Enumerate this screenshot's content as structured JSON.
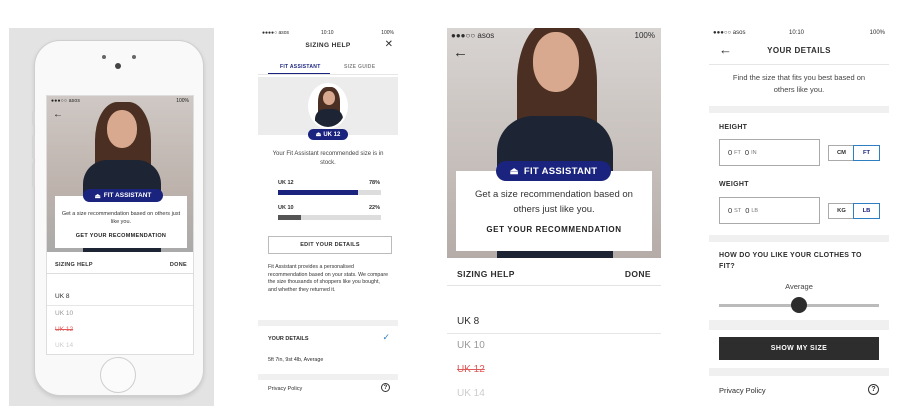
{
  "phone_preview": {
    "status_left": "●●●○○ asos",
    "status_right": "100%",
    "badge_label": "FIT ASSISTANT",
    "card_text": "Get a size recommendation based on others just like you.",
    "card_cta": "GET YOUR RECOMMENDATION",
    "bar_title": "SIZING HELP",
    "bar_done": "DONE",
    "sizes": [
      "UK 8",
      "UK 10",
      "UK 12",
      "UK 14"
    ]
  },
  "sizing_help": {
    "status_left": "●●●●○ asos",
    "time": "10:10",
    "battery": "100%",
    "title": "SIZING HELP",
    "close_icon": "✕",
    "tabs": [
      "FIT ASSISTANT",
      "SIZE GUIDE"
    ],
    "badge_label": "UK 12",
    "recommendation": "Your Fit Assistant recommended size is in stock.",
    "bars": [
      {
        "label": "UK 12",
        "pct_label": "78%",
        "value": 0.78,
        "color": "#1a237e"
      },
      {
        "label": "UK 10",
        "pct_label": "22%",
        "value": 0.22,
        "color": "#555555"
      }
    ],
    "edit_label": "EDIT YOUR DETAILS",
    "description": "Fit Assistant provides a personalised recommendation based on your stats. We compare the size thousands of shoppers like you bought, and whether they returned it.",
    "your_details_label": "YOUR DETAILS",
    "your_details_value": "5ft 7in, 9st 4lb, Average",
    "privacy_label": "Privacy Policy"
  },
  "zoom": {
    "status_left": "●●●○○ asos",
    "battery": "100%",
    "badge_label": "FIT ASSISTANT",
    "card_text": "Get a size recommendation based on others just like you.",
    "card_cta": "GET YOUR RECOMMENDATION",
    "bar_title": "SIZING HELP",
    "bar_done": "DONE",
    "sizes": [
      "UK 8",
      "UK 10",
      "UK 12",
      "UK 14"
    ]
  },
  "your_details": {
    "status_left": "●●●○○ asos",
    "time": "10:10",
    "battery": "100%",
    "title": "YOUR DETAILS",
    "intro": "Find the size that fits you best based on others like you.",
    "height_label": "HEIGHT",
    "height_value": {
      "a": "0",
      "a_unit": "FT",
      "b": "0",
      "b_unit": "IN"
    },
    "height_units": [
      "CM",
      "FT"
    ],
    "weight_label": "WEIGHT",
    "weight_value": {
      "a": "0",
      "a_unit": "ST",
      "b": "0",
      "b_unit": "LB"
    },
    "weight_units": [
      "KG",
      "LB"
    ],
    "fit_question": "HOW DO YOU LIKE YOUR CLOTHES TO FIT?",
    "fit_value": "Average",
    "fit_level": 0.5,
    "cta": "SHOW MY SIZE",
    "privacy_label": "Privacy Policy"
  },
  "colors": {
    "accent": "#1a237e",
    "dark": "#2d2d2d",
    "sold_out": "#e05a5a",
    "link_blue": "#2d7fc1"
  }
}
